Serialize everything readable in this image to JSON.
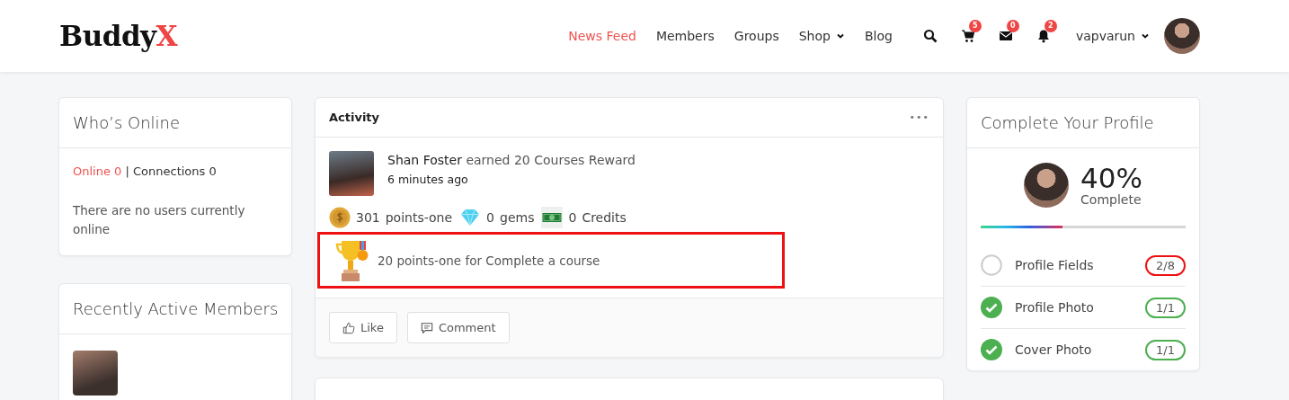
{
  "header": {
    "logo": {
      "main": "Buddy",
      "accent": "X"
    },
    "nav": [
      {
        "label": "News Feed",
        "selected": true,
        "dropdown": false
      },
      {
        "label": "Members",
        "selected": false,
        "dropdown": false
      },
      {
        "label": "Groups",
        "selected": false,
        "dropdown": false
      },
      {
        "label": "Shop",
        "selected": false,
        "dropdown": true
      },
      {
        "label": "Blog",
        "selected": false,
        "dropdown": false
      }
    ],
    "icons": [
      {
        "kind": "search"
      },
      {
        "kind": "cart",
        "badge": "5"
      },
      {
        "kind": "mail",
        "badge": "0"
      },
      {
        "kind": "bell",
        "badge": "2"
      }
    ],
    "user": {
      "name": "vapvarun"
    }
  },
  "who_online": {
    "title": "Who’s Online",
    "online": "Online 0",
    "connections": "| Connections 0",
    "message": "There are no users currently online"
  },
  "recent_members": {
    "title": "Recently Active Members"
  },
  "activity": {
    "title": "Activity",
    "menu": "•••",
    "post": {
      "author": "Shan Foster",
      "action": "earned 20 Courses Reward",
      "time": "6 minutes ago",
      "points": [
        {
          "kind": "coin",
          "value": "301",
          "label": "points-one"
        },
        {
          "kind": "gem",
          "value": "0",
          "label": "gems"
        },
        {
          "kind": "cash",
          "value": "0",
          "label": "Credits"
        }
      ],
      "reward": {
        "text": "20 points-one for Complete a course",
        "highlighted": true
      }
    },
    "actions": [
      {
        "kind": "like",
        "label": "Like"
      },
      {
        "kind": "comment",
        "label": "Comment"
      }
    ]
  },
  "profile": {
    "title": "Complete Your Profile",
    "percent": "40%",
    "caption": "Complete",
    "level": 0.4,
    "items": [
      {
        "label": "Profile Fields",
        "count": "2/8",
        "done": false
      },
      {
        "label": "Profile Photo",
        "count": "1/1",
        "done": true
      },
      {
        "label": "Cover Photo",
        "count": "1/1",
        "done": true
      }
    ]
  }
}
